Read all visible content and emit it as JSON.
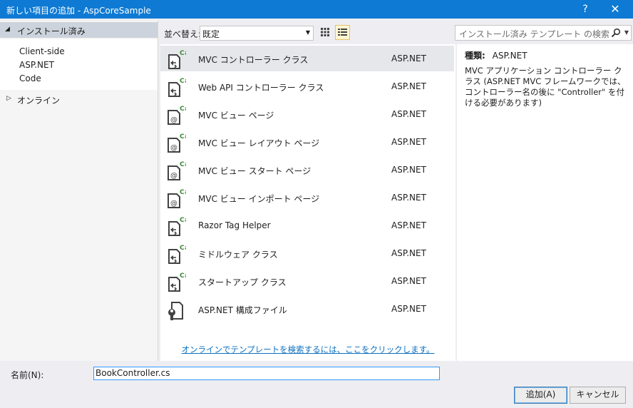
{
  "window": {
    "title": "新しい項目の追加 - AspCoreSample",
    "help_label": "?",
    "close_label": "✕"
  },
  "left_pane": {
    "installed_label": "インストール済み",
    "installed_items": [
      "Client-side",
      "ASP.NET",
      "Code"
    ],
    "online_label": "オンライン"
  },
  "toolbar": {
    "sort_label": "並べ替え:",
    "sort_value": "既定",
    "search_placeholder": "インストール済み テンプレート の検索 (Ctrl+E)"
  },
  "templates": [
    {
      "name": "MVC コントローラー クラス",
      "lang": "ASP.NET",
      "icon": "csharp-controller-icon",
      "selected": true
    },
    {
      "name": "Web API コントローラー クラス",
      "lang": "ASP.NET",
      "icon": "csharp-controller-icon"
    },
    {
      "name": "MVC ビュー ページ",
      "lang": "ASP.NET",
      "icon": "razor-page-icon"
    },
    {
      "name": "MVC ビュー レイアウト ページ",
      "lang": "ASP.NET",
      "icon": "razor-page-icon"
    },
    {
      "name": "MVC ビュー スタート ページ",
      "lang": "ASP.NET",
      "icon": "razor-page-icon"
    },
    {
      "name": "MVC ビュー インポート ページ",
      "lang": "ASP.NET",
      "icon": "razor-page-icon"
    },
    {
      "name": "Razor Tag Helper",
      "lang": "ASP.NET",
      "icon": "csharp-controller-icon"
    },
    {
      "name": "ミドルウェア クラス",
      "lang": "ASP.NET",
      "icon": "csharp-controller-icon"
    },
    {
      "name": "スタートアップ クラス",
      "lang": "ASP.NET",
      "icon": "csharp-controller-icon"
    },
    {
      "name": "ASP.NET 構成ファイル",
      "lang": "ASP.NET",
      "icon": "config-file-icon"
    }
  ],
  "online_link": "オンラインでテンプレートを検索するには、ここをクリックします。",
  "details": {
    "type_label": "種類:",
    "type_value": "ASP.NET",
    "description": "MVC アプリケーション コントローラー クラス (ASP.NET MVC フレームワークでは、コントローラー名の後に \"Controller\" を付ける必要があります)"
  },
  "footer": {
    "name_label": "名前(N):",
    "name_value": "BookController.cs",
    "add_label": "追加(A)",
    "cancel_label": "キャンセル"
  },
  "colors": {
    "titlebar": "#0e7ad3",
    "selected_bg": "#e6e7ea",
    "link": "#0e70c0",
    "icon_green": "#388a34"
  }
}
